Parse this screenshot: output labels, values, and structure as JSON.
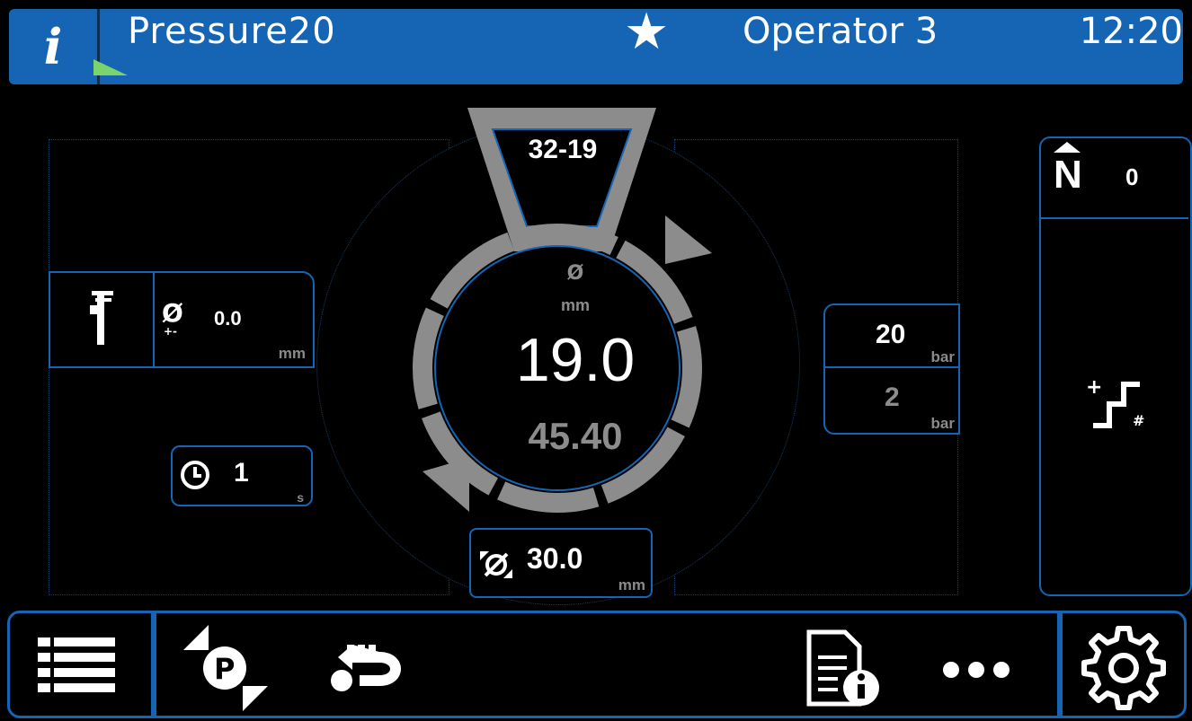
{
  "header": {
    "info_icon": "i",
    "title": "Pressure20",
    "favorite_icon": "★",
    "operator": "Operator 3",
    "time": "12:20"
  },
  "gauge": {
    "program": "32-19",
    "diameter_symbol": "Ø",
    "unit": "mm",
    "current_value": "19.0",
    "secondary_value": "45.40"
  },
  "target": {
    "value": "30.0",
    "unit": "mm"
  },
  "tolerance": {
    "symbol": "Ø",
    "value": "0.0",
    "unit": "mm"
  },
  "timer": {
    "value": "1",
    "unit": "s"
  },
  "pressure": {
    "high_value": "20",
    "high_unit": "bar",
    "low_value": "2",
    "low_unit": "bar"
  },
  "counter": {
    "label": "N",
    "value": "0"
  },
  "icons": {
    "info": "info-icon",
    "favorite": "star-icon",
    "caliper": "caliper-icon",
    "clock": "clock-icon",
    "step": "step-increment-icon",
    "menu": "list-menu-icon",
    "parking": "parking-swap-icon",
    "return": "return-arrow-icon",
    "document": "document-info-icon",
    "more": "more-icon",
    "settings": "gear-icon"
  },
  "colors": {
    "accent": "#1565b4",
    "gauge_gray": "#8c8c8c",
    "status_green": "#7bd36b"
  }
}
